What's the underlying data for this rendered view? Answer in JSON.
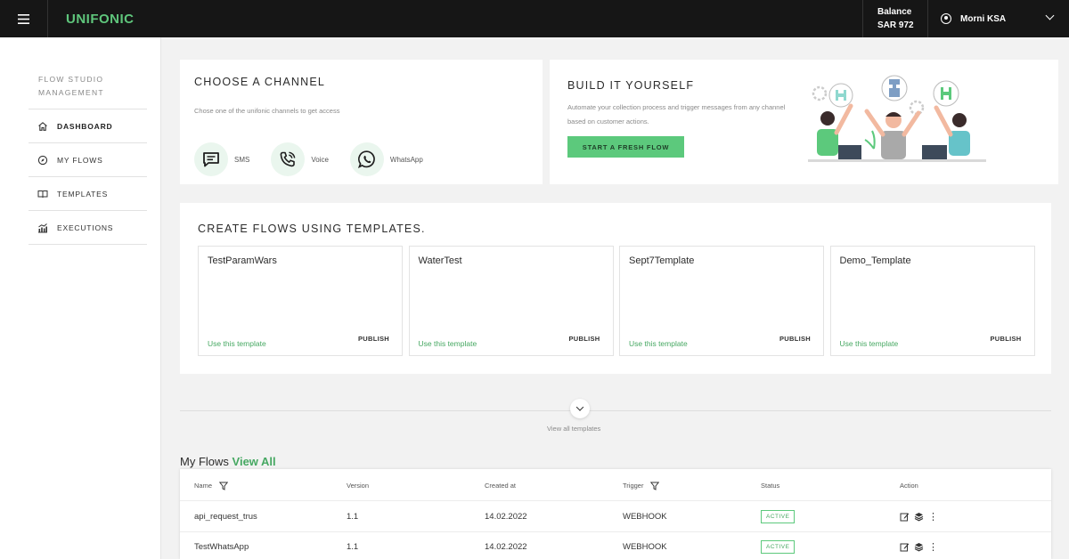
{
  "header": {
    "logo": "UNIFONIC",
    "balance_label": "Balance",
    "balance_value": "SAR 972",
    "user_name": "Morni KSA"
  },
  "sidebar": {
    "heading": "FLOW STUDIO MANAGEMENT",
    "items": [
      {
        "label": "DASHBOARD",
        "icon": "home-icon",
        "active": true
      },
      {
        "label": "MY FLOWS",
        "icon": "compass-icon",
        "active": false
      },
      {
        "label": "TEMPLATES",
        "icon": "book-icon",
        "active": false
      },
      {
        "label": "EXECUTIONS",
        "icon": "chart-icon",
        "active": false
      }
    ]
  },
  "channel_card": {
    "title": "CHOOSE A CHANNEL",
    "subtitle": "Chose one of the unifonic channels to get access",
    "channels": [
      {
        "label": "SMS",
        "icon": "sms-icon"
      },
      {
        "label": "Voice",
        "icon": "phone-icon"
      },
      {
        "label": "WhatsApp",
        "icon": "whatsapp-icon"
      }
    ]
  },
  "build_card": {
    "title": "BUILD IT YOURSELF",
    "description": "Automate your collection process and trigger messages from any channel based on customer actions.",
    "button_label": "START A FRESH FLOW"
  },
  "templates": {
    "title": "CREATE FLOWS USING TEMPLATES.",
    "items": [
      {
        "name": "TestParamWars",
        "use_label": "Use this template",
        "publish_label": "PUBLISH"
      },
      {
        "name": "WaterTest",
        "use_label": "Use this template",
        "publish_label": "PUBLISH"
      },
      {
        "name": "Sept7Template",
        "use_label": "Use this template",
        "publish_label": "PUBLISH"
      },
      {
        "name": "Demo_Template",
        "use_label": "Use this template",
        "publish_label": "PUBLISH"
      }
    ],
    "view_all_label": "View all templates"
  },
  "my_flows": {
    "title": "My Flows",
    "view_all": "View All",
    "columns": [
      "Name",
      "Version",
      "Created at",
      "Trigger",
      "Status",
      "Action"
    ],
    "rows": [
      {
        "name": "api_request_trus",
        "version": "1.1",
        "created": "14.02.2022",
        "trigger": "WEBHOOK",
        "status": "ACTIVE"
      },
      {
        "name": "TestWhatsApp",
        "version": "1.1",
        "created": "14.02.2022",
        "trigger": "WEBHOOK",
        "status": "ACTIVE"
      }
    ]
  },
  "colors": {
    "accent": "#5cc97c",
    "topbar": "#161616",
    "link": "#46a862"
  }
}
